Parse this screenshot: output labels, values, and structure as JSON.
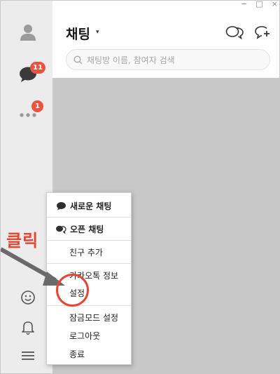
{
  "window": {
    "controls": [
      "−",
      "□",
      "×"
    ]
  },
  "sidebar": {
    "items": [
      {
        "name": "friends",
        "icon": "person-icon"
      },
      {
        "name": "chats",
        "icon": "chat-bubble-icon",
        "badge": "11"
      },
      {
        "name": "more",
        "icon": "more-dots-icon",
        "badge": "1"
      },
      {
        "name": "emoticon",
        "icon": "smiley-icon"
      },
      {
        "name": "notifications",
        "icon": "bell-icon"
      },
      {
        "name": "menu",
        "icon": "hamburger-menu-icon"
      }
    ]
  },
  "header": {
    "title": "채팅",
    "caret": "▾"
  },
  "search": {
    "placeholder": "채팅방 이름, 참여자 검색"
  },
  "menu": {
    "items": [
      {
        "label": "새로운 채팅",
        "bold": true
      },
      {
        "label": "오픈 채팅",
        "bold": true
      },
      {
        "label": "친구 추가"
      },
      {
        "label": "카카오톡 정보"
      },
      {
        "label": "설정"
      },
      {
        "label": "잠금모드 설정"
      },
      {
        "label": "로그아웃"
      },
      {
        "label": "종료"
      }
    ]
  },
  "annotation": {
    "label": "클릭",
    "color": "#e8442f"
  },
  "colors": {
    "badge": "#e9533f",
    "sidebar_bg": "#ececec",
    "list_bg": "#c8c8c8"
  }
}
